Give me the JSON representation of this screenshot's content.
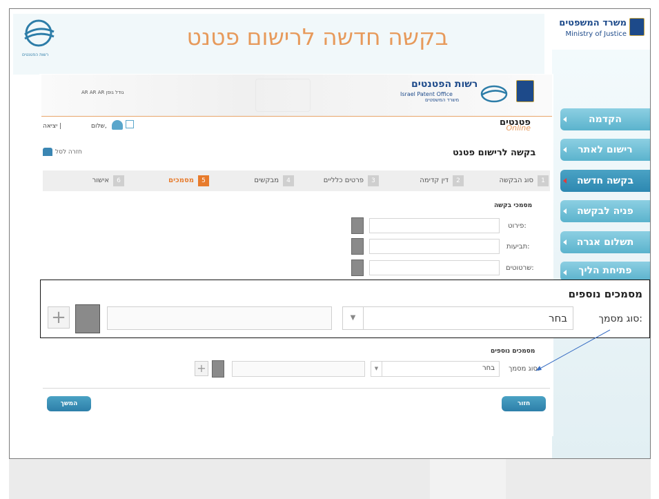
{
  "header": {
    "title": "בקשה חדשה לרישום פטנט",
    "left_logo_caption": "רשות הפטנטים",
    "ministry_hebrew": "משרד המשפטים",
    "ministry_english": "Ministry of Justice"
  },
  "sidebar": {
    "items": [
      {
        "label": "הקדמה",
        "active": false
      },
      {
        "label": "רישום לאתר",
        "active": false
      },
      {
        "label": "בקשה חדשה",
        "active": true
      },
      {
        "label": "פניה לבקשה",
        "active": false
      },
      {
        "label": "תשלום אגרה",
        "active": false
      },
      {
        "label": "פתיחת הליך",
        "active": false
      }
    ]
  },
  "inner": {
    "lang_links": "AR  AR  AR  גודל גופן",
    "agency_hebrew": "רשות הפטנטים",
    "agency_english": "Israel Patent Office",
    "agency_sub": "משרד המשפטים",
    "brand_hebrew": "פטנטים",
    "brand_online": "Online",
    "exit_label": "יציאה |",
    "hello_label": "שלום,",
    "subtitle": "בקשה לרישום פטנט",
    "back_label": "חזרה לסל"
  },
  "steps": [
    {
      "num": "1",
      "label": "סוג הבקשה"
    },
    {
      "num": "2",
      "label": "דין קדימה"
    },
    {
      "num": "3",
      "label": "פרטים כלליים"
    },
    {
      "num": "4",
      "label": "מבקשים"
    },
    {
      "num": "5",
      "label": "מסמכים",
      "current": true
    },
    {
      "num": "6",
      "label": "אישור"
    }
  ],
  "docs": {
    "heading": "מסמכי בקשה",
    "rows": [
      {
        "label": "פירוט:"
      },
      {
        "label": "תביעות:"
      },
      {
        "label": "שרטוטים:"
      }
    ]
  },
  "callout": {
    "title": "מסמכים נוספים",
    "type_label": "סוג מסמך:",
    "select_value": "בחר",
    "plus": "+"
  },
  "additional": {
    "heading": "מסמכים נוספים",
    "type_label": "סוג מסמך:",
    "select_value": "בחר"
  },
  "buttons": {
    "continue": "המשך",
    "back": "חזור"
  },
  "colors": {
    "accent_blue": "#2d88b1",
    "title_orange": "#e79a5b",
    "step_current": "#e77b2c"
  }
}
